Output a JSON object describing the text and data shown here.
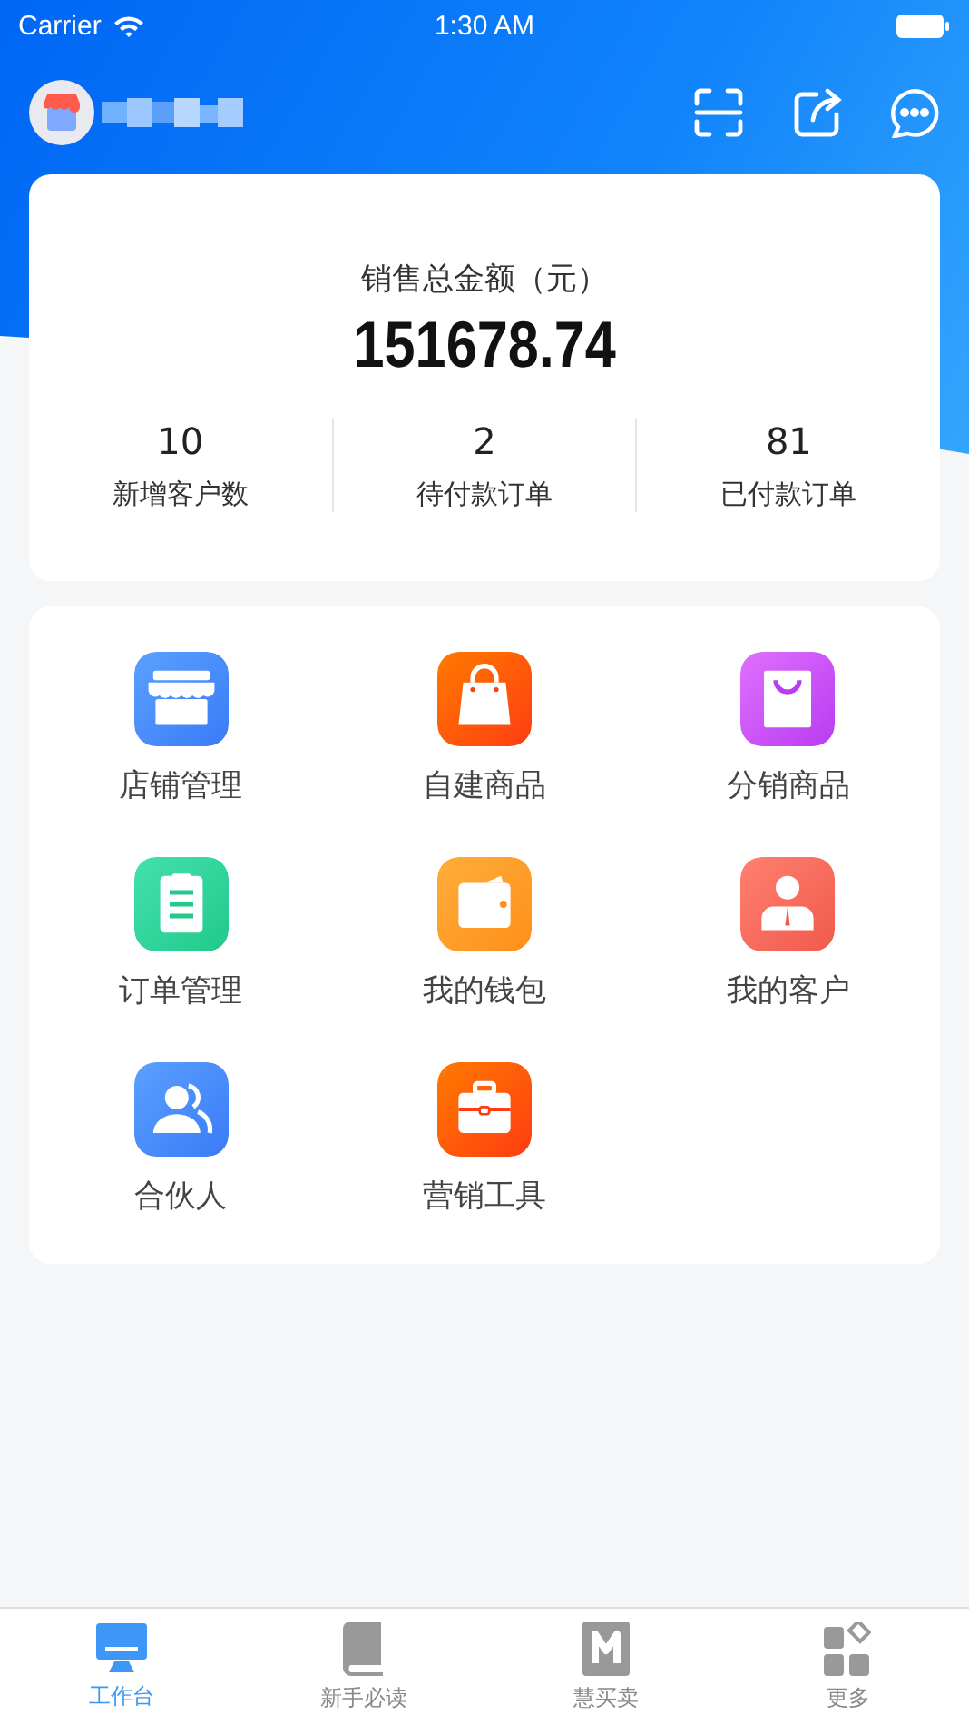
{
  "status_bar": {
    "carrier": "Carrier",
    "time": "1:30 AM"
  },
  "summary": {
    "title": "销售总金额（元）",
    "amount": "151678.74",
    "stats": [
      {
        "value": "10",
        "label": "新增客户数"
      },
      {
        "value": "2",
        "label": "待付款订单"
      },
      {
        "value": "81",
        "label": "已付款订单"
      }
    ]
  },
  "features": [
    {
      "kind": "store",
      "label": "店铺管理"
    },
    {
      "kind": "bag",
      "label": "自建商品"
    },
    {
      "kind": "tote",
      "label": "分销商品"
    },
    {
      "kind": "clipboard",
      "label": "订单管理"
    },
    {
      "kind": "wallet",
      "label": "我的钱包"
    },
    {
      "kind": "person",
      "label": "我的客户"
    },
    {
      "kind": "people",
      "label": "合伙人"
    },
    {
      "kind": "briefcase",
      "label": "营销工具"
    }
  ],
  "tab_bar": [
    {
      "kind": "monitor",
      "label": "工作台",
      "selected": true
    },
    {
      "kind": "book",
      "label": "新手必读",
      "selected": false
    },
    {
      "kind": "logo",
      "label": "慧买卖",
      "selected": false
    },
    {
      "kind": "grid",
      "label": "更多",
      "selected": false
    }
  ]
}
